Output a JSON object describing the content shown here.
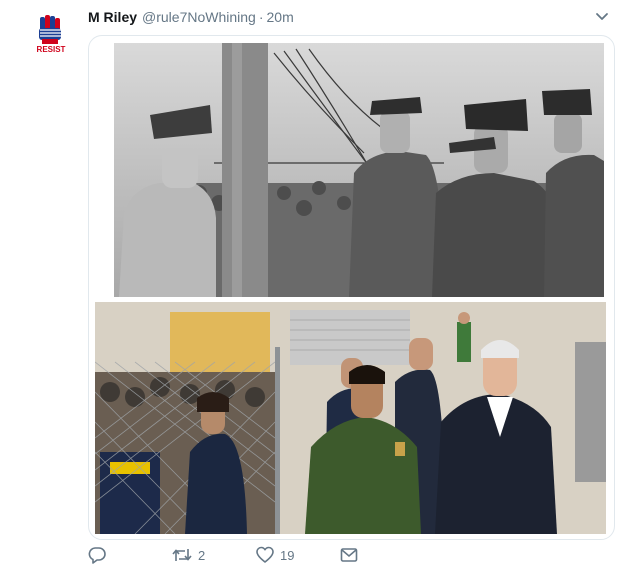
{
  "tweet": {
    "author_name": "M Riley",
    "author_handle": "@rule7NoWhining",
    "separator": "·",
    "timestamp": "20m",
    "avatar_icon": "fist-logo-avatar",
    "avatar_text": "RESIST",
    "menu_icon": "chevron-down-icon"
  },
  "media": {
    "images": [
      {
        "name": "historical-black-and-white-photo",
        "kind": "photo"
      },
      {
        "name": "color-detention-facility-photo",
        "kind": "photo"
      }
    ]
  },
  "actions": {
    "reply": {
      "icon": "reply-icon",
      "count": ""
    },
    "retweet": {
      "icon": "retweet-icon",
      "count": "2"
    },
    "like": {
      "icon": "heart-icon",
      "count": "19"
    },
    "message": {
      "icon": "envelope-icon",
      "count": ""
    }
  },
  "colors": {
    "text": "#14171a",
    "secondary": "#657786",
    "border": "#e1e8ed",
    "avatar_red": "#d0021b",
    "avatar_blue": "#1c3f94"
  }
}
